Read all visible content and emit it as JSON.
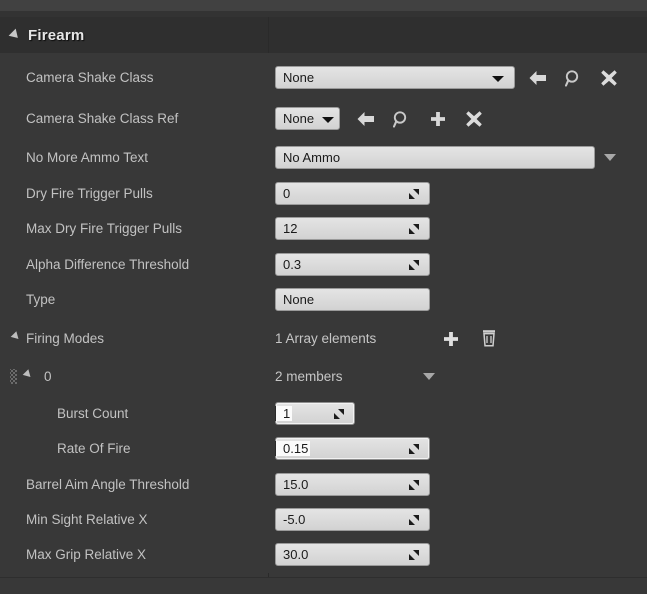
{
  "panel": {
    "category": {
      "title": "Firearm",
      "expanded": true,
      "collapse_icon": "triangle-down-icon"
    }
  },
  "rows": [
    {
      "id": "camera-shake-class",
      "label": "Camera Shake Class",
      "indent": 0,
      "control": "class-picker",
      "value": "None",
      "actions": [
        "back-arrow-icon",
        "browse-icon",
        "clear-icon"
      ]
    },
    {
      "id": "camera-shake-class-ref",
      "label": "Camera Shake Class Ref",
      "indent": 0,
      "control": "asset-picker",
      "value": "None",
      "actions": [
        "back-arrow-icon",
        "browse-icon",
        "add-icon",
        "clear-icon"
      ]
    },
    {
      "id": "no-more-ammo-text",
      "label": "No More Ammo Text",
      "indent": 0,
      "control": "text-with-caret",
      "value": "No Ammo",
      "actions": [
        "chevron-down-icon"
      ]
    },
    {
      "id": "dry-fire-trigger-pulls",
      "label": "Dry Fire Trigger Pulls",
      "indent": 0,
      "control": "spinner",
      "value": "0"
    },
    {
      "id": "max-dry-fire-trigger-pulls",
      "label": "Max Dry Fire Trigger Pulls",
      "indent": 0,
      "control": "spinner",
      "value": "12"
    },
    {
      "id": "alpha-difference-threshold",
      "label": "Alpha Difference Threshold",
      "indent": 0,
      "control": "spinner",
      "value": "0.3"
    },
    {
      "id": "type",
      "label": "Type",
      "indent": 0,
      "control": "text",
      "value": "None"
    },
    {
      "id": "firing-modes",
      "label": "Firing Modes",
      "indent": 0,
      "control": "array-header",
      "value": "1 Array elements",
      "expanded": true,
      "actions": [
        "add-element-icon",
        "delete-all-icon"
      ]
    },
    {
      "id": "firing-modes-0",
      "label": "0",
      "indent": 1,
      "control": "struct-header",
      "value": "2 members",
      "expanded": true,
      "actions": [
        "chevron-down-icon"
      ],
      "has_drag_handle": true
    },
    {
      "id": "burst-count",
      "label": "Burst Count",
      "indent": 2,
      "control": "spinner",
      "value": "1",
      "focused": true,
      "narrow": true
    },
    {
      "id": "rate-of-fire",
      "label": "Rate Of Fire",
      "indent": 2,
      "control": "spinner",
      "value": "0.15",
      "focused": true
    },
    {
      "id": "barrel-aim-angle-threshold",
      "label": "Barrel Aim Angle Threshold",
      "indent": 0,
      "control": "spinner",
      "value": "15.0"
    },
    {
      "id": "min-sight-relative-x",
      "label": "Min Sight Relative X",
      "indent": 0,
      "control": "spinner",
      "value": "-5.0"
    },
    {
      "id": "max-grip-relative-x",
      "label": "Max Grip Relative X",
      "indent": 0,
      "control": "spinner",
      "value": "30.0"
    }
  ],
  "colors": {
    "panel_bg": "#383838",
    "header_bg": "#2f2f2f",
    "field_bg": "#dcdcdc",
    "label_text": "#c2c2c2",
    "divider": "#2a2a2a"
  }
}
